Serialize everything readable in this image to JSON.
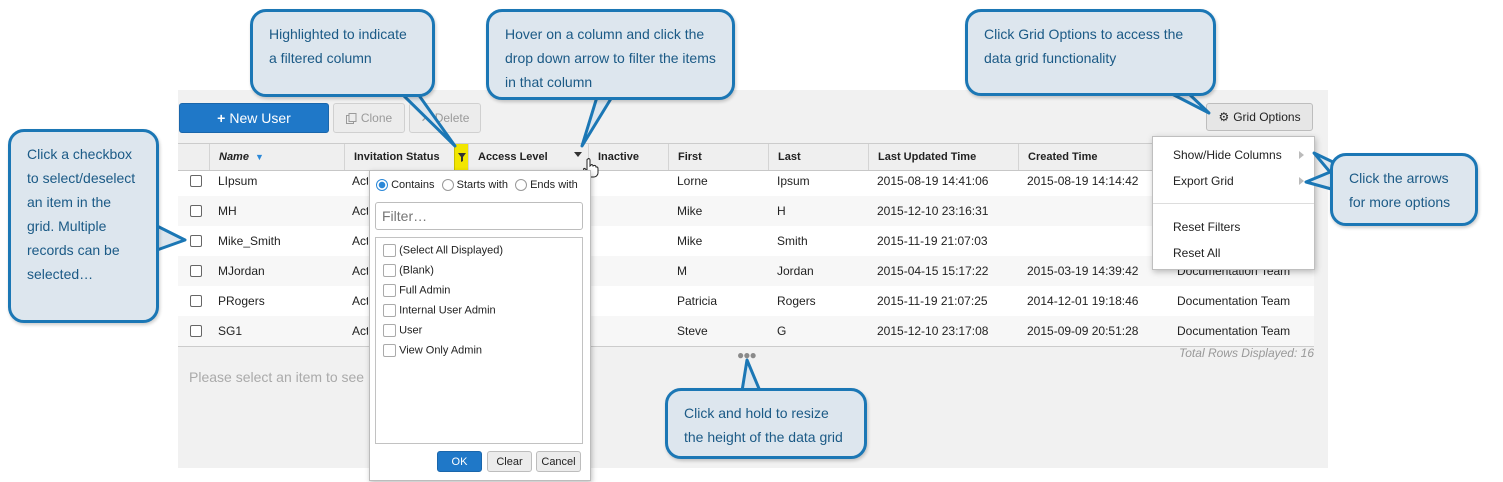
{
  "toolbar": {
    "new_user_label": "New User",
    "clone_label": "Clone",
    "delete_label": "Delete",
    "grid_options_label": "Grid Options"
  },
  "grid": {
    "columns": [
      "Name",
      "Invitation Status",
      "Access Level",
      "Inactive",
      "First",
      "Last",
      "Last Updated Time",
      "Created Time"
    ],
    "rows": [
      {
        "name": "LIpsum",
        "status": "Act",
        "first": "Lorne",
        "last": "Ipsum",
        "updated": "2015-08-19 14:41:06",
        "created": "2015-08-19 14:14:42",
        "team": ""
      },
      {
        "name": "MH",
        "status": "Act",
        "first": "Mike",
        "last": "H",
        "updated": "2015-12-10 23:16:31",
        "created": "",
        "team": ""
      },
      {
        "name": "Mike_Smith",
        "status": "Act",
        "first": "Mike",
        "last": "Smith",
        "updated": "2015-11-19 21:07:03",
        "created": "",
        "team": ""
      },
      {
        "name": "MJordan",
        "status": "Act",
        "first": "M",
        "last": "Jordan",
        "updated": "2015-04-15 15:17:22",
        "created": "2015-03-19 14:39:42",
        "team": "Documentation Team"
      },
      {
        "name": "PRogers",
        "status": "Act",
        "first": "Patricia",
        "last": "Rogers",
        "updated": "2015-11-19 21:07:25",
        "created": "2014-12-01 19:18:46",
        "team": "Documentation Team"
      },
      {
        "name": "SG1",
        "status": "Act",
        "first": "Steve",
        "last": "G",
        "updated": "2015-12-10 23:17:08",
        "created": "2015-09-09 20:51:28",
        "team": "Documentation Team"
      }
    ],
    "total_rows": "Total Rows Displayed: 16",
    "empty_message": "Please select an item to see"
  },
  "filter_popup": {
    "contains_label": "Contains",
    "starts_with_label": "Starts with",
    "ends_with_label": "Ends with",
    "filter_placeholder": "Filter…",
    "options": [
      "(Select All Displayed)",
      "(Blank)",
      "Full Admin",
      "Internal User Admin",
      "User",
      "View Only Admin"
    ],
    "ok_label": "OK",
    "clear_label": "Clear",
    "cancel_label": "Cancel"
  },
  "grid_options_menu": {
    "items": [
      "Show/Hide Columns",
      "Export Grid",
      "Reset Filters",
      "Reset All"
    ]
  },
  "callouts": {
    "highlighted": "Highlighted to indicate a filtered column",
    "hover": "Hover on a column and click the drop down arrow to filter the items in that column",
    "grid_options": "Click Grid Options to access the data grid functionality",
    "checkbox": "Click a checkbox to select/deselect an item in the grid. Multiple records can be selected…",
    "arrows": "Click the arrows for more options",
    "resize": "Click and hold to resize the height of the data grid"
  },
  "colors": {
    "primary": "#1f78c8",
    "filter_highlight": "#f2e600",
    "callout_border": "#1b77b5",
    "callout_fill": "#dde6ee"
  }
}
